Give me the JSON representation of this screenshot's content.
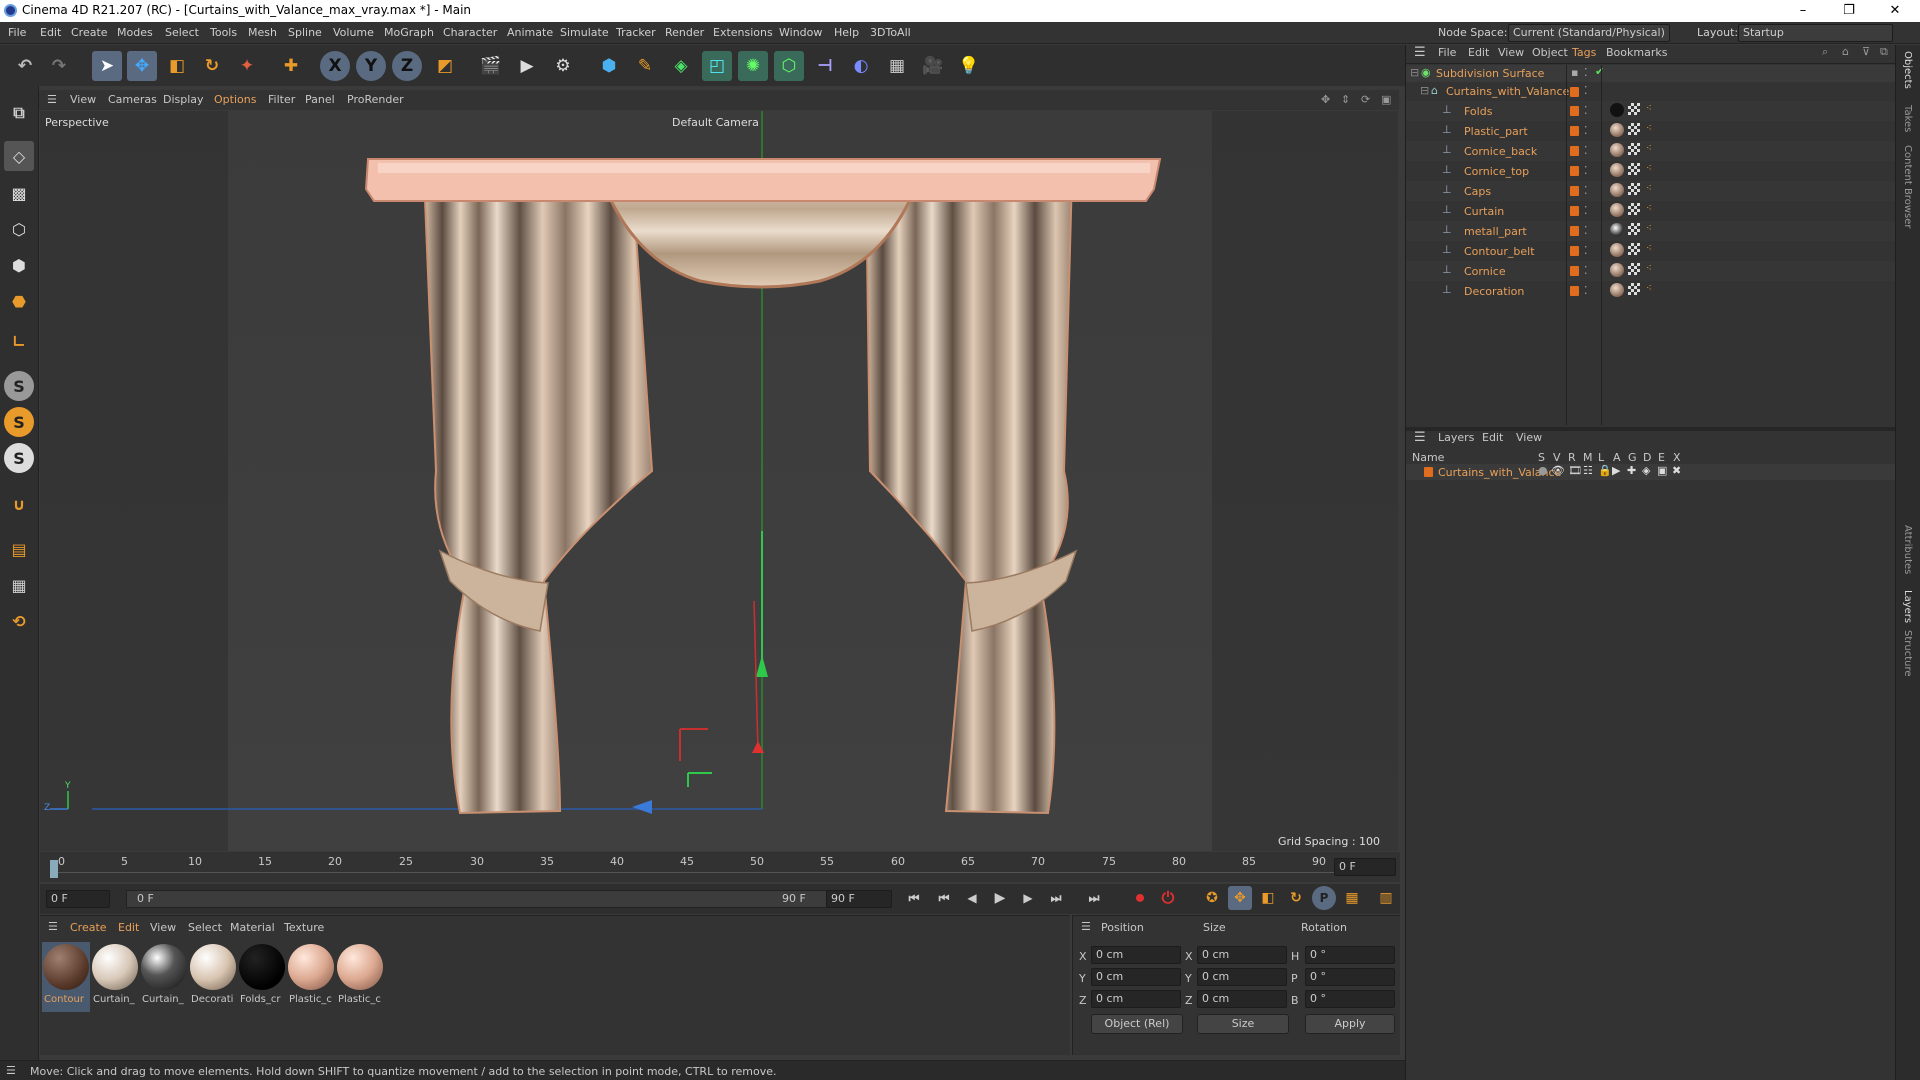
{
  "window": {
    "title": "Cinema 4D R21.207 (RC) - [Curtains_with_Valance_max_vray.max *] - Main",
    "min": "–",
    "max": "❐",
    "close": "✕"
  },
  "menu": [
    "File",
    "Edit",
    "Create",
    "Modes",
    "Select",
    "Tools",
    "Mesh",
    "Spline",
    "Volume",
    "MoGraph",
    "Character",
    "Animate",
    "Simulate",
    "Tracker",
    "Render",
    "Extensions",
    "Window",
    "Help",
    "3DToAll"
  ],
  "nodespace": {
    "label": "Node Space:",
    "value": "Current (Standard/Physical)"
  },
  "layout": {
    "label": "Layout:",
    "value": "Startup"
  },
  "viewport_menu": [
    "View",
    "Cameras",
    "Display",
    "Options",
    "Filter",
    "Panel",
    "ProRender"
  ],
  "viewport": {
    "name": "Perspective",
    "camera": "Default Camera",
    "grid": "Grid Spacing : 100 cm",
    "axis_y": "Y",
    "axis_z": "Z"
  },
  "timeline": {
    "ticks": [
      "0",
      "5",
      "10",
      "15",
      "20",
      "25",
      "30",
      "35",
      "40",
      "45",
      "50",
      "55",
      "60",
      "65",
      "70",
      "75",
      "80",
      "85",
      "90"
    ],
    "current": "0 F"
  },
  "playbar": {
    "start": "0 F",
    "range_start": "0 F",
    "range_end": "90 F",
    "end": "90 F"
  },
  "mat_menu": [
    "Create",
    "Edit",
    "View",
    "Select",
    "Material",
    "Texture"
  ],
  "materials": [
    {
      "name": "Contour",
      "color": "radial-gradient(circle at 35% 30%,#a08070,#5a3a2a 60%,#2a1a12)"
    },
    {
      "name": "Curtain_",
      "color": "radial-gradient(circle at 35% 30%,#fff,#d8c8b8 50%,#6a5a4a)"
    },
    {
      "name": "Curtain_",
      "color": "radial-gradient(circle at 35% 30%,#fff,#555 40%,#111)"
    },
    {
      "name": "Decorati",
      "color": "radial-gradient(circle at 35% 30%,#fff,#d8c4b0 50%,#6a5848)"
    },
    {
      "name": "Folds_cr",
      "color": "radial-gradient(circle at 35% 30%,#222,#000 70%)"
    },
    {
      "name": "Plastic_c",
      "color": "radial-gradient(circle at 35% 30%,#ffe8dc,#dca890 50%,#7a5040)"
    },
    {
      "name": "Plastic_c",
      "color": "radial-gradient(circle at 35% 30%,#ffe8dc,#dca890 50%,#7a5040)"
    }
  ],
  "coords": {
    "headers": [
      "Position",
      "Size",
      "Rotation"
    ],
    "rows": [
      {
        "axis": "X",
        "pos": "0 cm",
        "saxis": "X",
        "size": "0 cm",
        "raxis": "H",
        "rot": "0 °"
      },
      {
        "axis": "Y",
        "pos": "0 cm",
        "saxis": "Y",
        "size": "0 cm",
        "raxis": "P",
        "rot": "0 °"
      },
      {
        "axis": "Z",
        "pos": "0 cm",
        "saxis": "Z",
        "size": "0 cm",
        "raxis": "B",
        "rot": "0 °"
      }
    ],
    "mode": "Object (Rel)",
    "size_mode": "Size",
    "apply": "Apply"
  },
  "status": "Move: Click and drag to move elements. Hold down SHIFT to quantize movement / add to the selection in point mode, CTRL to remove.",
  "objects_menu": [
    "File",
    "Edit",
    "View",
    "Object",
    "Tags",
    "Bookmarks"
  ],
  "objects": {
    "root": "Subdivision Surface",
    "group": "Curtains_with_Valance",
    "children": [
      "Folds",
      "Plastic_part",
      "Cornice_back",
      "Cornice_top",
      "Caps",
      "Curtain",
      "metall_part",
      "Contour_belt",
      "Cornice",
      "Decoration"
    ]
  },
  "layers_menu": [
    "Layers",
    "Edit",
    "View"
  ],
  "layers": {
    "header_name": "Name",
    "cols": [
      "S",
      "V",
      "R",
      "M",
      "L",
      "A",
      "G",
      "D",
      "E",
      "X"
    ],
    "row": "Curtains_with_Valance"
  },
  "side_tabs": [
    "Objects",
    "Takes",
    "Content Browser",
    "Attributes",
    "Layers",
    "Structure"
  ]
}
